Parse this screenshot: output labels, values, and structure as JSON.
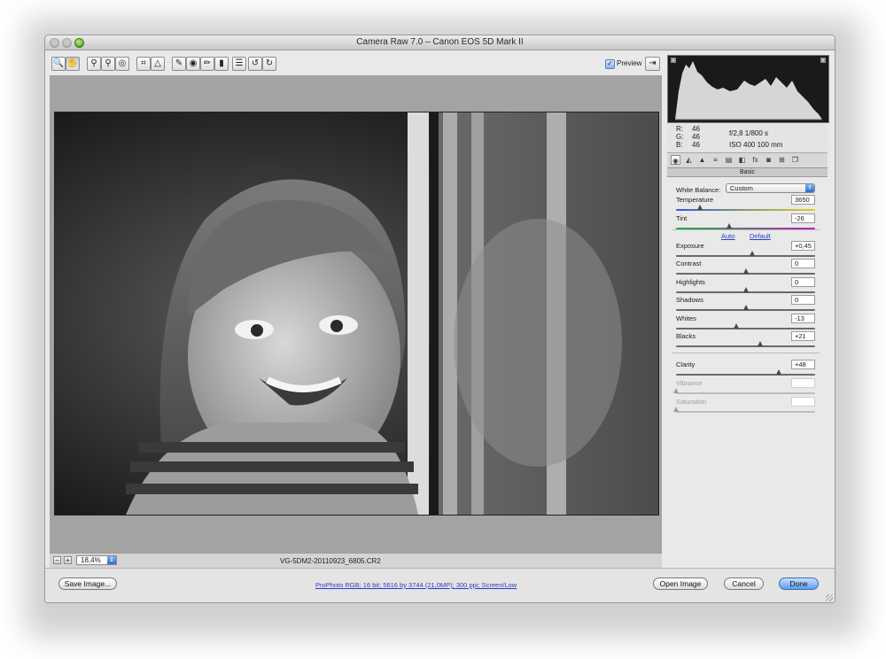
{
  "window": {
    "title": "Camera Raw 7.0  –  Canon EOS 5D Mark II"
  },
  "toolbar": {
    "tools": [
      {
        "name": "zoom-tool",
        "glyph": "🔍"
      },
      {
        "name": "hand-tool",
        "glyph": "✋"
      },
      {
        "name": "white-balance-tool",
        "glyph": "⚲"
      },
      {
        "name": "color-sampler-tool",
        "glyph": "⚲"
      },
      {
        "name": "targeted-adjustment-tool",
        "glyph": "◎"
      },
      {
        "name": "crop-tool",
        "glyph": "⌗"
      },
      {
        "name": "straighten-tool",
        "glyph": "△"
      },
      {
        "name": "spot-removal-tool",
        "glyph": "✎"
      },
      {
        "name": "red-eye-tool",
        "glyph": "◉"
      },
      {
        "name": "adjustment-brush-tool",
        "glyph": "✏"
      },
      {
        "name": "graduated-filter-tool",
        "glyph": "▮"
      },
      {
        "name": "preferences-tool",
        "glyph": "☰"
      },
      {
        "name": "rotate-left-tool",
        "glyph": "↺"
      },
      {
        "name": "rotate-right-tool",
        "glyph": "↻"
      }
    ],
    "preview_label": "Preview",
    "preview_checked": "✓",
    "fullscreen_glyph": "⇥"
  },
  "canvas": {
    "zoom": "18,4%",
    "filename": "VG-5DM2-20110923_6805.CR2"
  },
  "histogram": {
    "r_label": "R:",
    "g_label": "G:",
    "b_label": "B:",
    "r": "46",
    "g": "46",
    "b": "46",
    "aperture_shutter": "f/2,8    1/800 s",
    "iso_lens": "ISO 400    100 mm"
  },
  "panel_tabs": [
    "◉",
    "◭",
    "▲",
    "≡",
    "▤",
    "◧",
    "fx",
    "◙",
    "⊞",
    "❐"
  ],
  "panel": {
    "title": "Basic",
    "wb_label": "White Balance:",
    "wb_value": "Custom",
    "auto": "Auto",
    "default": "Default",
    "sliders": [
      {
        "key": "temperature",
        "label": "Temperature",
        "value": "3650",
        "pos": 0.17,
        "enabled": true
      },
      {
        "key": "tint",
        "label": "Tint",
        "value": "-26",
        "pos": 0.38,
        "enabled": true
      },
      {
        "key": "exposure",
        "label": "Exposure",
        "value": "+0,45",
        "pos": 0.55,
        "enabled": true
      },
      {
        "key": "contrast",
        "label": "Contrast",
        "value": "0",
        "pos": 0.5,
        "enabled": true
      },
      {
        "key": "highlights",
        "label": "Highlights",
        "value": "0",
        "pos": 0.5,
        "enabled": true
      },
      {
        "key": "shadows",
        "label": "Shadows",
        "value": "0",
        "pos": 0.5,
        "enabled": true
      },
      {
        "key": "whites",
        "label": "Whites",
        "value": "-13",
        "pos": 0.435,
        "enabled": true
      },
      {
        "key": "blacks",
        "label": "Blacks",
        "value": "+21",
        "pos": 0.605,
        "enabled": true
      },
      {
        "key": "clarity",
        "label": "Clarity",
        "value": "+48",
        "pos": 0.74,
        "enabled": true
      },
      {
        "key": "vibrance",
        "label": "Vibrance",
        "value": "",
        "pos": 0.0,
        "enabled": false
      },
      {
        "key": "saturation",
        "label": "Saturation",
        "value": "",
        "pos": 0.0,
        "enabled": false
      }
    ]
  },
  "bottom": {
    "save_image": "Save Image...",
    "workflow_link": "ProPhoto RGB; 16 bit; 5616 by 3744 (21,0MP); 300 ppi; Screen/Low",
    "open_image": "Open Image",
    "cancel": "Cancel",
    "done": "Done"
  },
  "colors": {
    "accent": "#5b9cf0",
    "link": "#2a3ec6",
    "canvas_bg": "#a3a3a3"
  }
}
